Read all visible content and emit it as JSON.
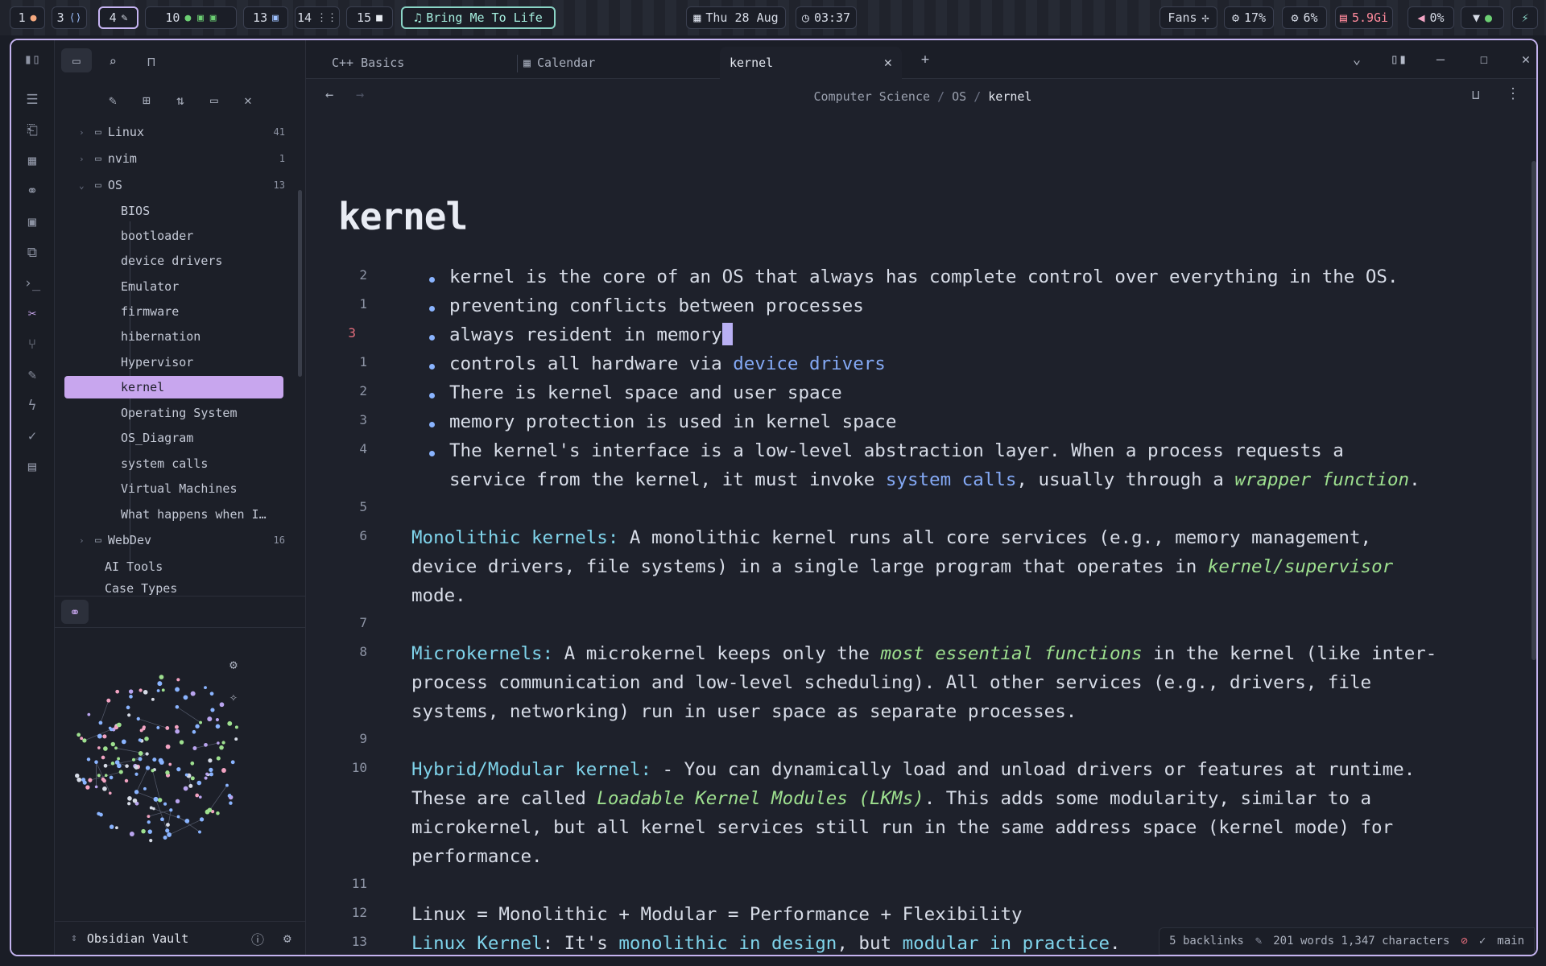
{
  "topbar": {
    "workspaces": [
      {
        "num": "1",
        "icon": "●"
      },
      {
        "num": "3",
        "icon": "⟨⟩"
      },
      {
        "num": "4",
        "icon": "✎"
      },
      {
        "num": "10",
        "icon": "● ▣ ▣"
      },
      {
        "num": "13",
        "icon": "▣"
      },
      {
        "num": "14",
        "icon": "⋮⋮"
      },
      {
        "num": "15",
        "icon": "■"
      }
    ],
    "music": "Bring Me To Life",
    "date": "Thu 28 Aug",
    "time": "03:37",
    "fans_label": "Fans",
    "cpu": "17%",
    "gpu": "6%",
    "mem": "5.9Gi",
    "volume": "0%"
  },
  "sidebar": {
    "tree": [
      {
        "label": "Linux",
        "count": "41",
        "type": "folder"
      },
      {
        "label": "nvim",
        "count": "1",
        "type": "folder"
      },
      {
        "label": "OS",
        "count": "13",
        "type": "folder-open"
      },
      {
        "label": "BIOS",
        "type": "file"
      },
      {
        "label": "bootloader",
        "type": "file"
      },
      {
        "label": "device drivers",
        "type": "file"
      },
      {
        "label": "Emulator",
        "type": "file"
      },
      {
        "label": "firmware",
        "type": "file"
      },
      {
        "label": "hibernation",
        "type": "file"
      },
      {
        "label": "Hypervisor",
        "type": "file"
      },
      {
        "label": "kernel",
        "type": "file",
        "selected": true
      },
      {
        "label": "Operating System",
        "type": "file"
      },
      {
        "label": "OS_Diagram",
        "type": "file"
      },
      {
        "label": "system calls",
        "type": "file"
      },
      {
        "label": "Virtual Machines",
        "type": "file"
      },
      {
        "label": "What happens when I…",
        "type": "file"
      },
      {
        "label": "WebDev",
        "count": "16",
        "type": "folder"
      },
      {
        "label": "AI Tools",
        "type": "root-file"
      },
      {
        "label": "Case Types",
        "type": "root-file"
      }
    ],
    "vault_name": "Obsidian Vault"
  },
  "tabs": [
    {
      "label": "C++ Basics"
    },
    {
      "label": "Calendar"
    },
    {
      "label": "kernel"
    }
  ],
  "breadcrumb": [
    "Computer Science",
    "OS",
    "kernel"
  ],
  "note": {
    "title": "kernel",
    "line_numbers": [
      "2",
      "1",
      "3",
      "1",
      "2",
      "3",
      "4",
      "5",
      "6",
      "7",
      "8",
      "9",
      "10",
      "11",
      "12",
      "13"
    ],
    "bullets": [
      [
        "kernel is the core of an OS that always has complete control over everything in the OS."
      ],
      [
        "preventing conflicts between processes"
      ],
      [
        "always resident in memory"
      ],
      [
        "controls all hardware via ",
        "device drivers"
      ],
      [
        "There is kernel space and user space"
      ],
      [
        "memory protection is used in kernel space"
      ],
      [
        "The kernel's interface is a low-level abstraction layer. When a process requests a",
        "service from the kernel, it must invoke ",
        "system calls",
        ", usually through a ",
        "wrapper function",
        "."
      ]
    ],
    "mono": {
      "head": "Monolithic kernels:",
      "l1": " A monolithic kernel runs all core services (e.g., memory management,",
      "l2a": "device drivers, file systems) in a single large program that operates in ",
      "l2em": "kernel/supervisor",
      "l3": "mode."
    },
    "micro": {
      "head": "Microkernels:",
      "l1a": " A microkernel keeps only the ",
      "l1em": "most essential functions",
      "l1b": " in the kernel (like inter-",
      "l2": "process communication and low-level scheduling). All other services (e.g., drivers, file",
      "l3": "systems, networking) run in user space as separate processes."
    },
    "hybrid": {
      "head": "Hybrid/Modular kernel:",
      "l1": " - You can dynamically load and unload drivers or features at runtime.",
      "l2a": "These are called ",
      "l2em": "Loadable Kernel Modules (LKMs)",
      "l2b": ". This adds some modularity, similar to a",
      "l3": "microkernel, but all kernel services still run in the same address space (kernel mode) for",
      "l4": "performance."
    },
    "linux_eq": "Linux = Monolithic + Modular = Performance + Flexibility",
    "linux_kernel": {
      "head": "Linux Kernel",
      "a": ": It's ",
      "b": "monolithic in design",
      "c": ", but ",
      "d": "modular in practice",
      "e": "."
    }
  },
  "status": {
    "backlinks": "5 backlinks",
    "counts": "201 words 1,347 characters",
    "branch": "main"
  },
  "colors": {
    "accent": "#c8a6ee",
    "link": "#84a9f5",
    "emphasis": "#9ee08f",
    "heading": "#7fd3ea"
  }
}
